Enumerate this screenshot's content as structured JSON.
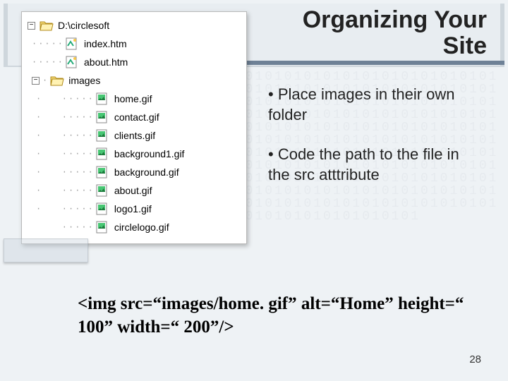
{
  "title": "Organizing Your Site",
  "bullets": [
    "Place images in their own folder",
    "Code the path to the file in the src atttribute"
  ],
  "code": "<img src=“images/home. gif” alt=“Home” height=“ 100” width=“ 200”/>",
  "page_number": "28",
  "tree": {
    "root": {
      "label": "D:\\circlesoft",
      "expanded": true,
      "type": "folder"
    },
    "children": [
      {
        "label": "index.htm",
        "type": "htm"
      },
      {
        "label": "about.htm",
        "type": "htm"
      },
      {
        "label": "images",
        "type": "folder",
        "expanded": true,
        "children": [
          {
            "label": "home.gif",
            "type": "gif"
          },
          {
            "label": "contact.gif",
            "type": "gif"
          },
          {
            "label": "clients.gif",
            "type": "gif"
          },
          {
            "label": "background1.gif",
            "type": "gif"
          },
          {
            "label": "background.gif",
            "type": "gif"
          },
          {
            "label": "about.gif",
            "type": "gif"
          },
          {
            "label": "logo1.gif",
            "type": "gif"
          },
          {
            "label": "circlelogo.gif",
            "type": "gif"
          }
        ]
      }
    ]
  }
}
